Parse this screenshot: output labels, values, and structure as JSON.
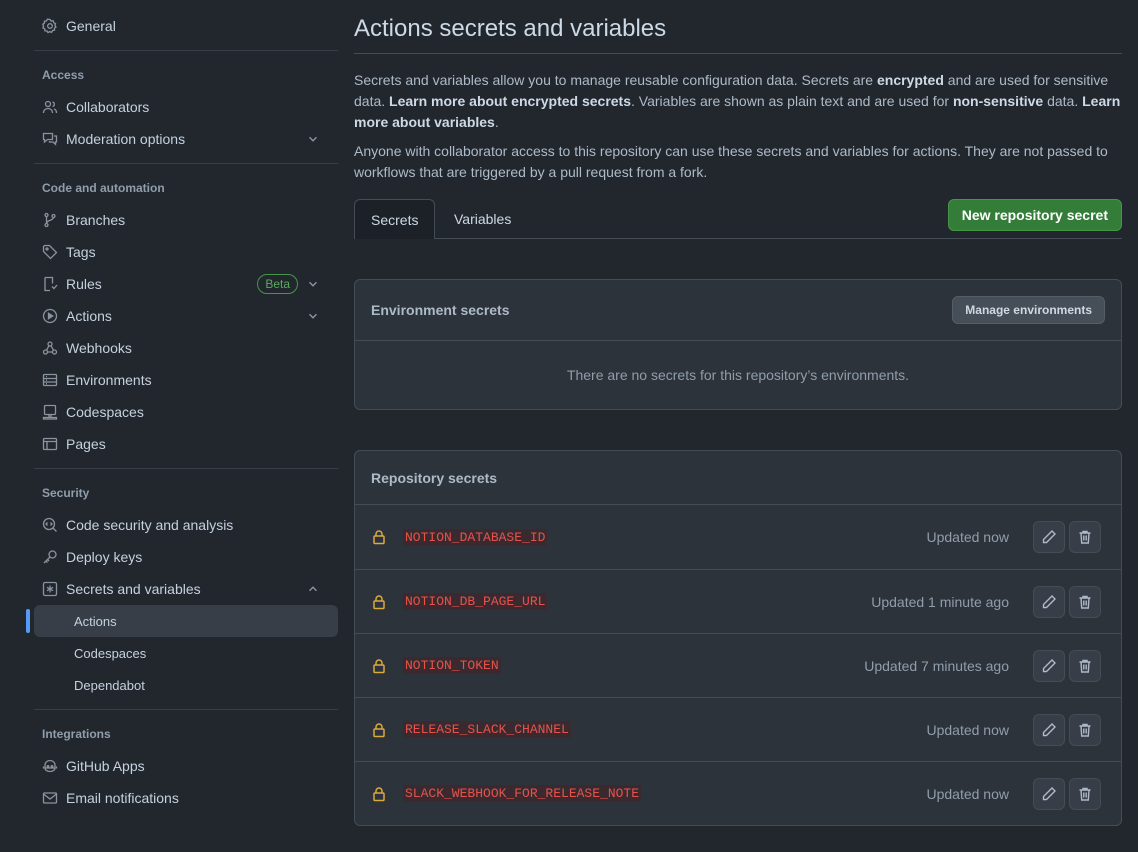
{
  "sidebar": {
    "general": "General",
    "access_title": "Access",
    "access": [
      {
        "label": "Collaborators"
      },
      {
        "label": "Moderation options"
      }
    ],
    "code_title": "Code and automation",
    "code": [
      {
        "label": "Branches"
      },
      {
        "label": "Tags"
      },
      {
        "label": "Rules",
        "badge": "Beta"
      },
      {
        "label": "Actions"
      },
      {
        "label": "Webhooks"
      },
      {
        "label": "Environments"
      },
      {
        "label": "Codespaces"
      },
      {
        "label": "Pages"
      }
    ],
    "security_title": "Security",
    "security": [
      {
        "label": "Code security and analysis"
      },
      {
        "label": "Deploy keys"
      },
      {
        "label": "Secrets and variables"
      }
    ],
    "secrets_sub": [
      {
        "label": "Actions"
      },
      {
        "label": "Codespaces"
      },
      {
        "label": "Dependabot"
      }
    ],
    "integrations_title": "Integrations",
    "integrations": [
      {
        "label": "GitHub Apps"
      },
      {
        "label": "Email notifications"
      }
    ]
  },
  "main": {
    "title": "Actions secrets and variables",
    "desc": {
      "p1": "Secrets and variables allow you to manage reusable configuration data. Secrets are ",
      "b1": "encrypted",
      "p2": " and are used for sensitive data. ",
      "link1": "Learn more about encrypted secrets",
      "p3": ". Variables are shown as plain text and are used for ",
      "b2": "non-sensitive",
      "p4": " data. ",
      "link2": "Learn more about variables",
      "p5": "."
    },
    "desc2": "Anyone with collaborator access to this repository can use these secrets and variables for actions. They are not passed to workflows that are triggered by a pull request from a fork.",
    "tabs": [
      {
        "label": "Secrets"
      },
      {
        "label": "Variables"
      }
    ],
    "new_secret_button": "New repository secret",
    "env_box": {
      "title": "Environment secrets",
      "manage_button": "Manage environments",
      "empty": "There are no secrets for this repository’s environments."
    },
    "repo_box": {
      "title": "Repository secrets",
      "secrets": [
        {
          "name": "NOTION_DATABASE_ID",
          "updated": "Updated now"
        },
        {
          "name": "NOTION_DB_PAGE_URL",
          "updated": "Updated 1 minute ago"
        },
        {
          "name": "NOTION_TOKEN",
          "updated": "Updated 7 minutes ago"
        },
        {
          "name": "RELEASE_SLACK_CHANNEL",
          "updated": "Updated now"
        },
        {
          "name": "SLACK_WEBHOOK_FOR_RELEASE_NOTE",
          "updated": "Updated now"
        }
      ]
    }
  }
}
